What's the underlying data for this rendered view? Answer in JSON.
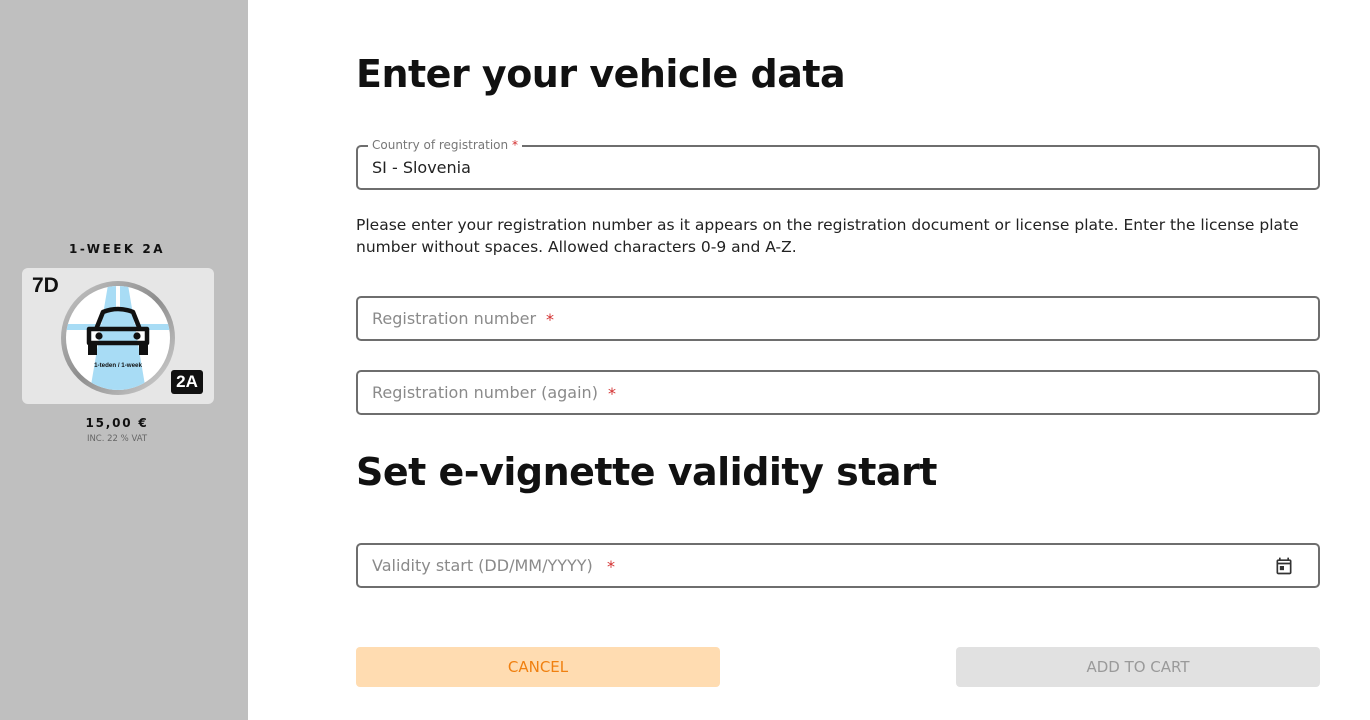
{
  "sidebar": {
    "product_title": "1-WEEK 2A",
    "vignette": {
      "duration_code": "7D",
      "class_code": "2A",
      "period_text": "1-teden / 1-week"
    },
    "price": "15,00 €",
    "vat_note": "INC. 22 % VAT"
  },
  "vehicle": {
    "heading": "Enter your vehicle data",
    "country": {
      "label": "Country of registration",
      "required_mark": "*",
      "value": "SI - Slovenia"
    },
    "help_text": "Please enter your registration number as it appears on the registration document or license plate. Enter the license plate number without spaces. Allowed characters 0-9 and A-Z.",
    "registration": {
      "placeholder": "Registration number",
      "required_mark": "*"
    },
    "registration_again": {
      "placeholder": "Registration number (again)",
      "required_mark": "*"
    }
  },
  "validity": {
    "heading": "Set e-vignette validity start",
    "start": {
      "placeholder": "Validity start (DD/MM/YYYY)",
      "required_mark": "*",
      "icon": "calendar-icon"
    }
  },
  "actions": {
    "cancel_label": "CANCEL",
    "add_to_cart_label": "ADD TO CART"
  },
  "colors": {
    "sidebar_bg": "#bfbfbf",
    "cancel_bg": "#ffdcb1",
    "cancel_text": "#f08010",
    "disabled_bg": "#e1e1e1",
    "disabled_text": "#9a9a9a",
    "required": "#d32f2f",
    "vignette_blue": "#a8dcf5"
  }
}
